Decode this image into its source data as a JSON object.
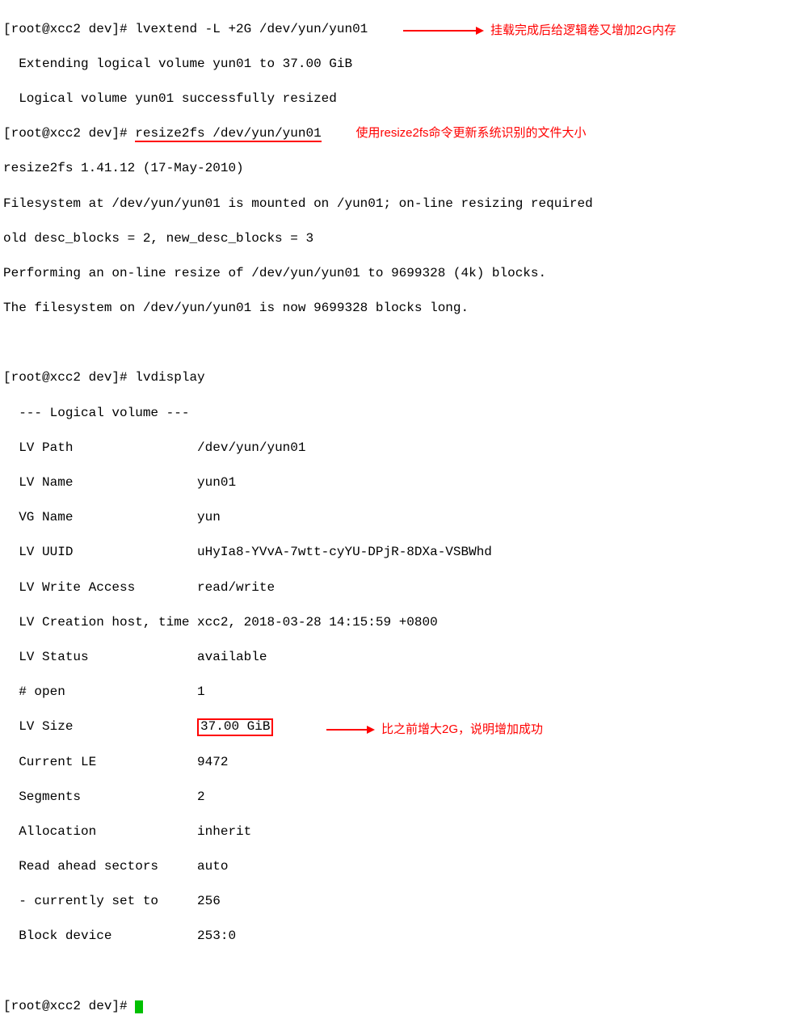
{
  "prompts": {
    "root": "[root@xcc2 dev]#"
  },
  "cmd": {
    "lvextend": "lvextend -L +2G /dev/yun/yun01",
    "resize2fs": "resize2fs /dev/yun/yun01",
    "lvdisplay": "lvdisplay"
  },
  "out": {
    "ext1": "  Extending logical volume yun01 to 37.00 GiB",
    "ext2": "  Logical volume yun01 successfully resized",
    "r1": "resize2fs 1.41.12 (17-May-2010)",
    "r2": "Filesystem at /dev/yun/yun01 is mounted on /yun01; on-line resizing required",
    "r3": "old desc_blocks = 2, new_desc_blocks = 3",
    "r4": "Performing an on-line resize of /dev/yun/yun01 to 9699328 (4k) blocks.",
    "r5": "The filesystem on /dev/yun/yun01 is now 9699328 blocks long.",
    "lv_header": "  --- Logical volume ---",
    "lv_path_k": "  LV Path               ",
    "lv_path_v": "/dev/yun/yun01",
    "lv_name_k": "  LV Name               ",
    "lv_name_v": "yun01",
    "vg_name_k": "  VG Name               ",
    "vg_name_v": "yun",
    "lv_uuid_k": "  LV UUID               ",
    "lv_uuid_v": "uHyIa8-YVvA-7wtt-cyYU-DPjR-8DXa-VSBWhd",
    "lv_wa_k": "  LV Write Access       ",
    "lv_wa_v": "read/write",
    "lv_ch_k": "  LV Creation host, time ",
    "lv_ch_v": "xcc2, 2018-03-28 14:15:59 +0800",
    "lv_st_k": "  LV Status             ",
    "lv_st_v": "available",
    "lv_op_k": "  # open                ",
    "lv_op_v": "1",
    "lv_sz_k": "  LV Size               ",
    "lv_sz_v": "37.00 GiB",
    "lv_le_k": "  Current LE            ",
    "lv_le_v": "9472",
    "lv_sg_k": "  Segments              ",
    "lv_sg_v": "2",
    "lv_al_k": "  Allocation            ",
    "lv_al_v": "inherit",
    "lv_ra_k": "  Read ahead sectors    ",
    "lv_ra_v": "auto",
    "lv_cs_k": "  - currently set to    ",
    "lv_cs_v": "256",
    "lv_bd_k": "  Block device          ",
    "lv_bd_v": "253:0"
  },
  "notes": {
    "n1": "挂载完成后给逻辑卷又增加2G内存",
    "n2": "使用resize2fs命令更新系统识别的文件大小",
    "n3": "比之前增大2G，说明增加成功"
  }
}
